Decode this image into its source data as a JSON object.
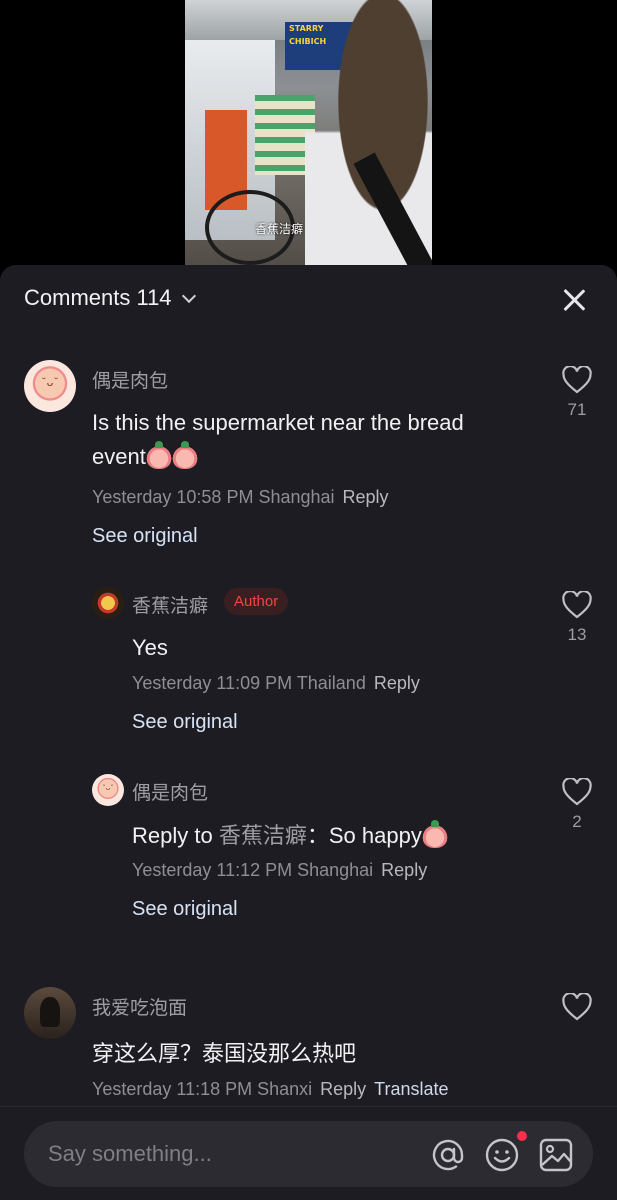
{
  "video": {
    "sign_text": "STARRY",
    "sign_text_2": "CHIBICH",
    "watermark": "香蕉洁癖"
  },
  "header": {
    "title": "Comments 114"
  },
  "comments": [
    {
      "username": "偶是肉包",
      "text_line1": "Is this the supermarket near the bread",
      "text_line2": "event",
      "time": "Yesterday 10:58 PM Shanghai",
      "reply_label": "Reply",
      "see_original": "See original",
      "likes": "71",
      "replies": [
        {
          "username": "香蕉洁癖",
          "badge": "Author",
          "text": "Yes",
          "time": "Yesterday 11:09 PM Thailand",
          "reply_label": "Reply",
          "see_original": "See original",
          "likes": "13"
        },
        {
          "username": "偶是肉包",
          "reply_prefix": "Reply to",
          "reply_to_name": "香蕉洁癖",
          "reply_text": "：So happy",
          "time": "Yesterday 11:12 PM Shanghai",
          "reply_label": "Reply",
          "see_original": "See original",
          "likes": "2"
        }
      ]
    },
    {
      "username": "我爱吃泡面",
      "text": "穿这么厚？泰国没那么热吧",
      "time": "Yesterday 11:18 PM Shanxi",
      "reply_label": "Reply",
      "translate_label": "Translate"
    }
  ],
  "input": {
    "placeholder": "Say something..."
  },
  "icons": [
    "close-icon",
    "chevron-down-icon",
    "heart-icon",
    "at-icon",
    "emoji-icon",
    "image-icon"
  ],
  "colors": {
    "sheet_bg": "#1d1c23",
    "author_badge": "#f0473f",
    "notification_dot": "#ff2e4d"
  }
}
